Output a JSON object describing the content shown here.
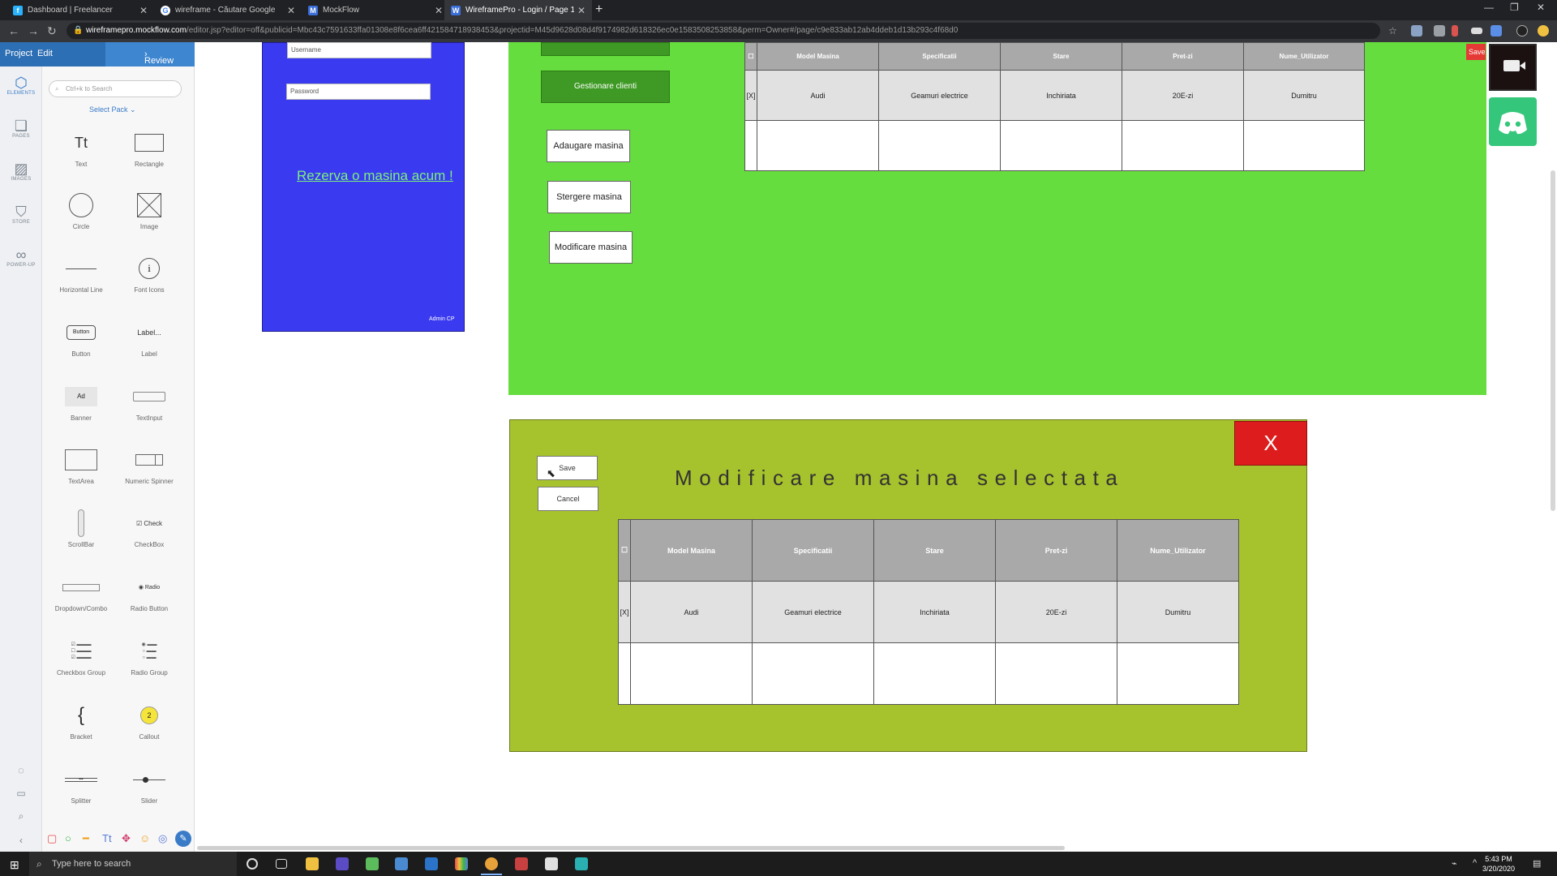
{
  "browser": {
    "tabs": [
      {
        "label": "Dashboard | Freelancer",
        "icon": "freelancer-icon",
        "active": false
      },
      {
        "label": "wireframe - Căutare Google",
        "icon": "google-icon",
        "active": false
      },
      {
        "label": "MockFlow",
        "icon": "mockflow-icon",
        "active": false
      },
      {
        "label": "WireframePro - Login / Page 1",
        "icon": "wireframepro-icon",
        "active": true
      }
    ],
    "url_host": "wireframepro.mockflow.com",
    "url_path": "/editor.jsp?editor=off&publicid=Mbc43c7591633ffa01308e8f6cea6ff421584718938453&projectid=M45d9628d08d4f9174982d618326ec0e1583508253858&perm=Owner#/page/c9e833ab12ab4ddeb1d13b293c4f68d0"
  },
  "editor": {
    "menu": {
      "project": "Project",
      "edit": "Edit",
      "review": "Review"
    },
    "rail": [
      {
        "label": "ELEMENTS",
        "icon": "cube-icon"
      },
      {
        "label": "PAGES",
        "icon": "pages-icon"
      },
      {
        "label": "IMAGES",
        "icon": "images-icon"
      },
      {
        "label": "STORE",
        "icon": "store-icon"
      },
      {
        "label": "POWER-UP",
        "icon": "powerup-icon"
      }
    ],
    "search_placeholder": "Ctrl+k to Search",
    "select_pack": "Select Pack",
    "palette": {
      "text": "Text",
      "text_glyph": "Tt",
      "rectangle": "Rectangle",
      "circle": "Circle",
      "image": "Image",
      "hline": "Horizontal Line",
      "fonticons": "Font Icons",
      "button": "Button",
      "button_preview": "Button",
      "label": "Label",
      "label_preview": "Label...",
      "banner": "Banner",
      "banner_preview": "Ad",
      "textinput": "TextInput",
      "textarea": "TextArea",
      "numericspinner": "Numeric Spinner",
      "scrollbar": "ScrollBar",
      "checkbox": "CheckBox",
      "checkbox_preview": "Check",
      "dropdown": "Dropdown/Combo",
      "radiobutton": "Radio Button",
      "radio_preview": "Radio",
      "checkboxgroup": "Checkbox Group",
      "radiogroup": "Radio Group",
      "bracket": "Bracket",
      "bracket_glyph": "{",
      "callout": "Callout",
      "callout_preview": "2",
      "splitter": "Splitter",
      "slider": "Slider"
    }
  },
  "canvas": {
    "login": {
      "username_placeholder": "Username",
      "password_placeholder": "Password",
      "link": "Rezerva o masina acum !",
      "admin": "Admin CP"
    },
    "admin_panel": {
      "gestionare_clienti": "Gestionare clienti",
      "adaugare": "Adaugare masina",
      "stergere": "Stergere masina",
      "modificare": "Modificare masina",
      "save_partial": "Save",
      "table": {
        "headers": [
          "☐",
          "Model Masina",
          "Specificatii",
          "Stare",
          "Pret-zi",
          "Nume_Utilizator"
        ],
        "row": [
          "[X]",
          "Audi",
          "Geamuri electrice",
          "Inchiriata",
          "20E-zi",
          "Dumitru"
        ]
      }
    },
    "dialog": {
      "title": "Modificare masina selectata",
      "close": "X",
      "save": "Save",
      "cancel": "Cancel",
      "table": {
        "headers": [
          "☐",
          "Model Masina",
          "Specificatii",
          "Stare",
          "Pret-zi",
          "Nume_Utilizator"
        ],
        "row": [
          "[X]",
          "Audi",
          "Geamuri electrice",
          "Inchiriata",
          "20E-zi",
          "Dumitru"
        ]
      }
    }
  },
  "taskbar": {
    "search_placeholder": "Type here to search",
    "time": "5:43 PM",
    "date": "3/20/2020"
  },
  "colors": {
    "login_panel": "#3a3af0",
    "admin_panel": "#66dd3e",
    "dialog": "#a6c22c",
    "close_button": "#dd1d1d",
    "header_cell": "#a9a9a9"
  }
}
